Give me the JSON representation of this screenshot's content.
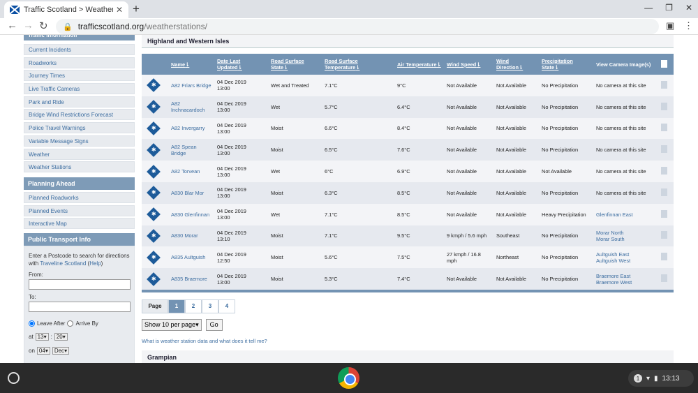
{
  "browser": {
    "tab_title": "Traffic Scotland > Weather Statio",
    "url_host": "trafficscotland.org",
    "url_path": "/weatherstations/"
  },
  "sidebar": {
    "top_cut_heading": "Traffic Information",
    "traffic_links": [
      "Current Incidents",
      "Roadworks",
      "Journey Times",
      "Live Traffic Cameras",
      "Park and Ride",
      "Bridge Wind Restrictions Forecast",
      "Police Travel Warnings",
      "Variable Message Signs",
      "Weather",
      "Weather Stations"
    ],
    "planning_heading": "Planning Ahead",
    "planning_links": [
      "Planned Roadworks",
      "Planned Events",
      "Interactive Map"
    ],
    "transport_heading": "Public Transport Info",
    "transport_intro_1": "Enter a Postcode to search for directions with",
    "traveline_link": "Traveline Scotland",
    "help_open": "(",
    "help_link": "Help",
    "help_close": ")",
    "from_label": "From:",
    "to_label": "To:",
    "leave_after": "Leave After",
    "arrive_by": "Arrive By",
    "at_label": "at",
    "hour": "13",
    "minute": "20",
    "colon": ":",
    "on_label": "on",
    "day": "04",
    "month": "Dec"
  },
  "main": {
    "region_title": "Highland and Western Isles",
    "headers": [
      "Name",
      "Date Last Updated",
      "Road Surface State",
      "Road Surface Temperature",
      "Air Temperature",
      "Wind Speed",
      "Wind Direction",
      "Precipitation State",
      "View Camera Image(s)"
    ],
    "rows": [
      {
        "name": "A82 Friars Bridge",
        "date": "04 Dec 2019",
        "time": "13:00",
        "road_state": "Wet and Treated",
        "road_temp": "7.1°C",
        "air_temp": "9°C",
        "wind_speed": "Not Available",
        "wind_dir": "Not Available",
        "precip": "No Precipitation",
        "camera": "No camera at this site",
        "camera2": ""
      },
      {
        "name": "A82 Inchnacardoch",
        "date": "04 Dec 2019",
        "time": "13:00",
        "road_state": "Wet",
        "road_temp": "5.7°C",
        "air_temp": "6.4°C",
        "wind_speed": "Not Available",
        "wind_dir": "Not Available",
        "precip": "No Precipitation",
        "camera": "No camera at this site",
        "camera2": ""
      },
      {
        "name": "A82 Invergarry",
        "date": "04 Dec 2019",
        "time": "13:00",
        "road_state": "Moist",
        "road_temp": "6.6°C",
        "air_temp": "8.4°C",
        "wind_speed": "Not Available",
        "wind_dir": "Not Available",
        "precip": "No Precipitation",
        "camera": "No camera at this site",
        "camera2": ""
      },
      {
        "name": "A82 Spean Bridge",
        "date": "04 Dec 2019",
        "time": "13:00",
        "road_state": "Moist",
        "road_temp": "6.5°C",
        "air_temp": "7.6°C",
        "wind_speed": "Not Available",
        "wind_dir": "Not Available",
        "precip": "No Precipitation",
        "camera": "No camera at this site",
        "camera2": ""
      },
      {
        "name": "A82 Torvean",
        "date": "04 Dec 2019",
        "time": "13:00",
        "road_state": "Wet",
        "road_temp": "6°C",
        "air_temp": "6.9°C",
        "wind_speed": "Not Available",
        "wind_dir": "Not Available",
        "precip": "Not Available",
        "camera": "No camera at this site",
        "camera2": ""
      },
      {
        "name": "A830 Blar Mor",
        "date": "04 Dec 2019",
        "time": "13:00",
        "road_state": "Moist",
        "road_temp": "6.3°C",
        "air_temp": "8.5°C",
        "wind_speed": "Not Available",
        "wind_dir": "Not Available",
        "precip": "No Precipitation",
        "camera": "No camera at this site",
        "camera2": ""
      },
      {
        "name": "A830 Glenfinnan",
        "date": "04 Dec 2019",
        "time": "13:00",
        "road_state": "Wet",
        "road_temp": "7.1°C",
        "air_temp": "8.5°C",
        "wind_speed": "Not Available",
        "wind_dir": "Not Available",
        "precip": "Heavy Precipitation",
        "camera": "Glenfinnan East",
        "camera2": ""
      },
      {
        "name": "A830 Morar",
        "date": "04 Dec 2019",
        "time": "13:10",
        "road_state": "Moist",
        "road_temp": "7.1°C",
        "air_temp": "9.5°C",
        "wind_speed": "9 kmph / 5.6 mph",
        "wind_dir": "Southeast",
        "precip": "No Precipitation",
        "camera": "Morar North",
        "camera2": "Morar South"
      },
      {
        "name": "A835 Aultguish",
        "date": "04 Dec 2019",
        "time": "12:50",
        "road_state": "Moist",
        "road_temp": "5.6°C",
        "air_temp": "7.5°C",
        "wind_speed": "27 kmph / 16.8 mph",
        "wind_dir": "Northeast",
        "precip": "No Precipitation",
        "camera": "Aultguish East",
        "camera2": "Aultguish West"
      },
      {
        "name": "A835 Braemore",
        "date": "04 Dec 2019",
        "time": "13:00",
        "road_state": "Moist",
        "road_temp": "5.3°C",
        "air_temp": "7.4°C",
        "wind_speed": "Not Available",
        "wind_dir": "Not Available",
        "precip": "No Precipitation",
        "camera": "Braemore East",
        "camera2": "Braemore West"
      }
    ],
    "pager_label": "Page",
    "pages": [
      "1",
      "2",
      "3",
      "4"
    ],
    "per_page": "Show 10 per page",
    "go_label": "Go",
    "question": "What is weather station data and what does it tell me?",
    "next_region": "Grampian"
  },
  "taskbar": {
    "notification_count": "1",
    "clock": "13:13"
  }
}
